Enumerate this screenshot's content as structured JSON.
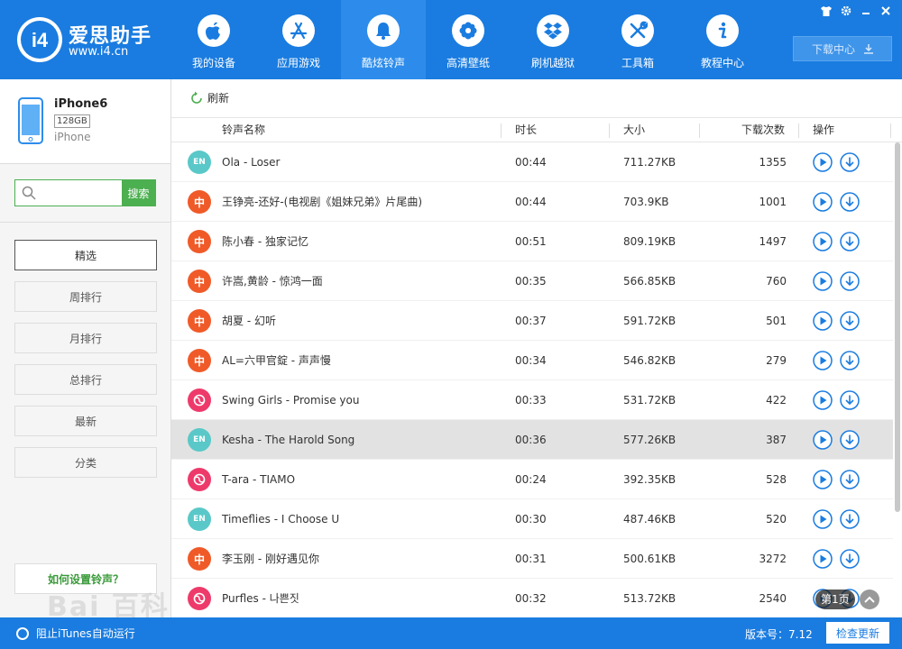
{
  "brand": {
    "logo_text": "i4",
    "title": "爱思助手",
    "url": "www.i4.cn"
  },
  "nav": [
    {
      "label": "我的设备",
      "icon": "apple-icon",
      "active": false
    },
    {
      "label": "应用游戏",
      "icon": "app-store-icon",
      "active": false
    },
    {
      "label": "酷炫铃声",
      "icon": "bell-icon",
      "active": true
    },
    {
      "label": "高清壁纸",
      "icon": "flower-icon",
      "active": false
    },
    {
      "label": "刷机越狱",
      "icon": "dropbox-icon",
      "active": false
    },
    {
      "label": "工具箱",
      "icon": "tools-icon",
      "active": false
    },
    {
      "label": "教程中心",
      "icon": "info-icon",
      "active": false
    }
  ],
  "window_controls": [
    "shirt-icon",
    "gear-icon",
    "minimize-icon",
    "close-icon"
  ],
  "download_center": "下载中心",
  "device": {
    "name": "iPhone6",
    "capacity": "128GB",
    "model": "iPhone"
  },
  "search": {
    "placeholder": "",
    "button": "搜索"
  },
  "categories": [
    {
      "label": "精选",
      "active": true
    },
    {
      "label": "周排行",
      "active": false
    },
    {
      "label": "月排行",
      "active": false
    },
    {
      "label": "总排行",
      "active": false
    },
    {
      "label": "最新",
      "active": false
    },
    {
      "label": "分类",
      "active": false
    }
  ],
  "how_to": "如何设置铃声？",
  "refresh_label": "刷新",
  "table": {
    "headers": {
      "name": "铃声名称",
      "duration": "时长",
      "size": "大小",
      "downloads": "下载次数",
      "actions": "操作"
    },
    "rows": [
      {
        "badge": "EN",
        "lang": "en",
        "name": "Ola - Loser",
        "duration": "00:44",
        "size": "711.27KB",
        "downloads": "1355"
      },
      {
        "badge": "中",
        "lang": "zh",
        "name": "王铮亮-还好-(电视剧《姐妹兄弟》片尾曲)",
        "duration": "00:44",
        "size": "703.9KB",
        "downloads": "1001"
      },
      {
        "badge": "中",
        "lang": "zh",
        "name": "陈小春 - 独家记忆",
        "duration": "00:51",
        "size": "809.19KB",
        "downloads": "1497"
      },
      {
        "badge": "中",
        "lang": "zh",
        "name": "许嵩,黄龄 - 惊鸿一面",
        "duration": "00:35",
        "size": "566.85KB",
        "downloads": "760"
      },
      {
        "badge": "中",
        "lang": "zh",
        "name": "胡夏 - 幻听",
        "duration": "00:37",
        "size": "591.72KB",
        "downloads": "501"
      },
      {
        "badge": "中",
        "lang": "zh",
        "name": "AL=六甲官錠 - 声声慢",
        "duration": "00:34",
        "size": "546.82KB",
        "downloads": "279"
      },
      {
        "badge": "",
        "lang": "kr",
        "name": "Swing Girls - Promise you",
        "duration": "00:33",
        "size": "531.72KB",
        "downloads": "422"
      },
      {
        "badge": "EN",
        "lang": "en",
        "name": "Kesha - The Harold Song",
        "duration": "00:36",
        "size": "577.26KB",
        "downloads": "387",
        "highlight": true
      },
      {
        "badge": "",
        "lang": "kr",
        "name": "T-ara - TIAMO",
        "duration": "00:24",
        "size": "392.35KB",
        "downloads": "528"
      },
      {
        "badge": "EN",
        "lang": "en",
        "name": "Timeflies - I Choose U",
        "duration": "00:30",
        "size": "487.46KB",
        "downloads": "520"
      },
      {
        "badge": "中",
        "lang": "zh",
        "name": "李玉刚 - 刚好遇见你",
        "duration": "00:31",
        "size": "500.61KB",
        "downloads": "3272"
      },
      {
        "badge": "",
        "lang": "kr",
        "name": "Purfles - 나쁜짓",
        "duration": "00:32",
        "size": "513.72KB",
        "downloads": "2540"
      }
    ]
  },
  "watermark": "Bai 百科",
  "page_badge": "第1页",
  "footer": {
    "itunes": "阻止iTunes自动运行",
    "version": "版本号：7.12",
    "update": "检查更新"
  },
  "colors": {
    "primary": "#1a7ce0",
    "green": "#4caf50",
    "en_badge": "#5ac8c8",
    "zh_badge": "#f05a28",
    "kr_badge": "#ee3a6a"
  }
}
